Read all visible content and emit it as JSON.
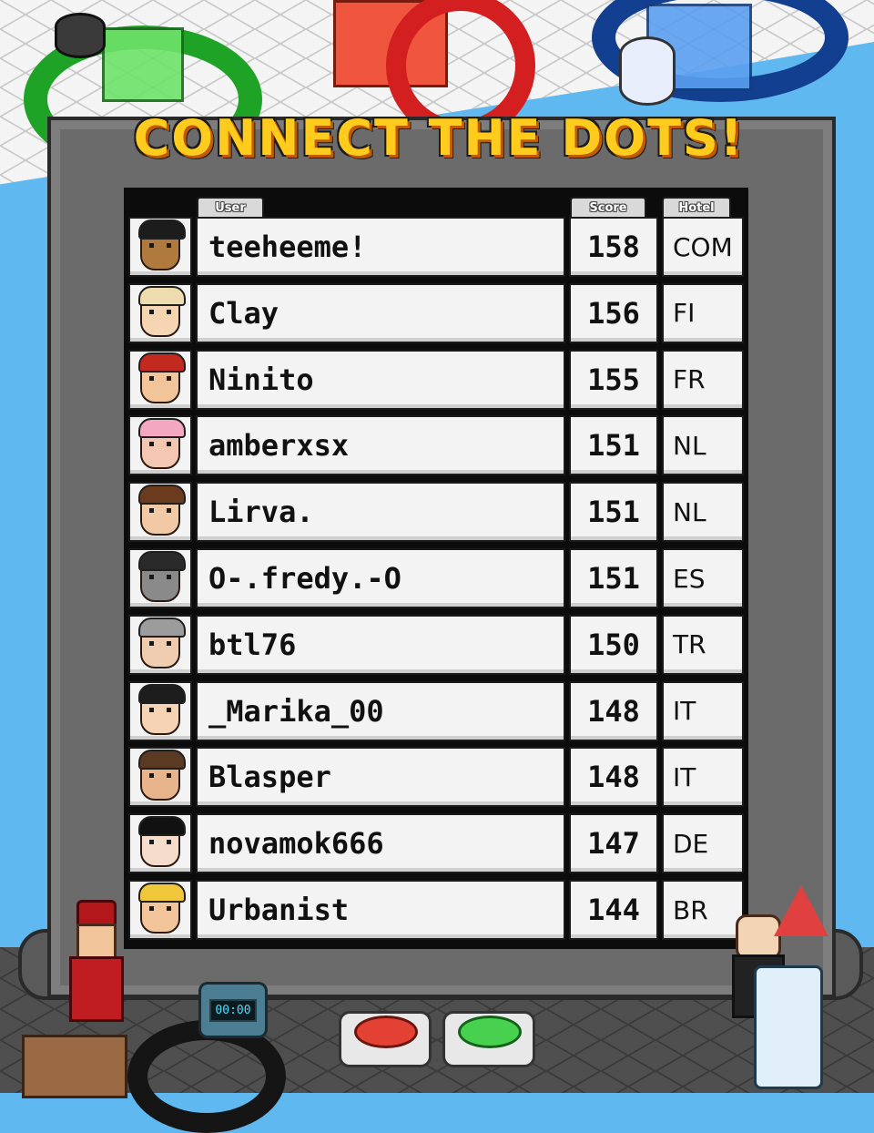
{
  "title": "CONNECT THE DOTS!",
  "headers": {
    "user": "User",
    "score": "Score",
    "hotel": "Hotel"
  },
  "rows": [
    {
      "user": "teeheeme!",
      "score": "158",
      "hotel": "COM",
      "skin": "#b07a3f",
      "hair": "#1c1c1c"
    },
    {
      "user": "Clay",
      "score": "156",
      "hotel": "FI",
      "skin": "#f6d6b2",
      "hair": "#efdcae"
    },
    {
      "user": "Ninito",
      "score": "155",
      "hotel": "FR",
      "skin": "#f2c49a",
      "hair": "#c22a20"
    },
    {
      "user": "amberxsx",
      "score": "151",
      "hotel": "NL",
      "skin": "#f4c7b2",
      "hair": "#f3a7c0"
    },
    {
      "user": "Lirva.",
      "score": "151",
      "hotel": "NL",
      "skin": "#f2c9a5",
      "hair": "#6b3b1e"
    },
    {
      "user": "O-.fredy.-O",
      "score": "151",
      "hotel": "ES",
      "skin": "#8a8a8a",
      "hair": "#2a2a2a"
    },
    {
      "user": "btl76",
      "score": "150",
      "hotel": "TR",
      "skin": "#f1cdb0",
      "hair": "#9c9c9c"
    },
    {
      "user": "_Marika_00",
      "score": "148",
      "hotel": "IT",
      "skin": "#f5d3b4",
      "hair": "#1d1d1d"
    },
    {
      "user": "Blasper",
      "score": "148",
      "hotel": "IT",
      "skin": "#e7b48c",
      "hair": "#5a3a22"
    },
    {
      "user": "novamok666",
      "score": "147",
      "hotel": "DE",
      "skin": "#f6dccb",
      "hair": "#111111"
    },
    {
      "user": "Urbanist",
      "score": "144",
      "hotel": "BR",
      "skin": "#f2c49a",
      "hair": "#f0c63a"
    }
  ],
  "timer_display": "00:00",
  "colors": {
    "title": "#ffcc1e",
    "cabinet": "#6b6b6b",
    "background": "#5fb8ef"
  }
}
